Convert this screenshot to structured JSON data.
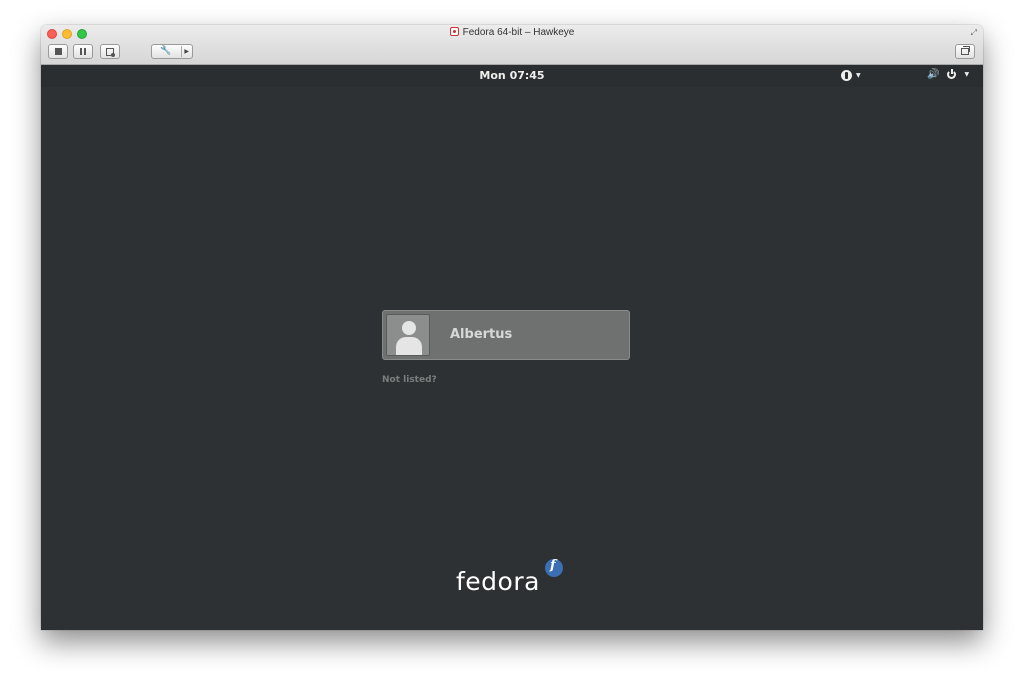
{
  "window": {
    "title": "Fedora 64-bit – Hawkeye"
  },
  "topbar": {
    "clock": "Mon 07:45"
  },
  "login": {
    "user_name": "Albertus",
    "not_listed_label": "Not listed?"
  },
  "branding": {
    "logo_text": "fedora"
  },
  "colors": {
    "screen_background": "#2e3133",
    "card_background": "#6f7070",
    "fedora_blue": "#3c6eb4"
  }
}
